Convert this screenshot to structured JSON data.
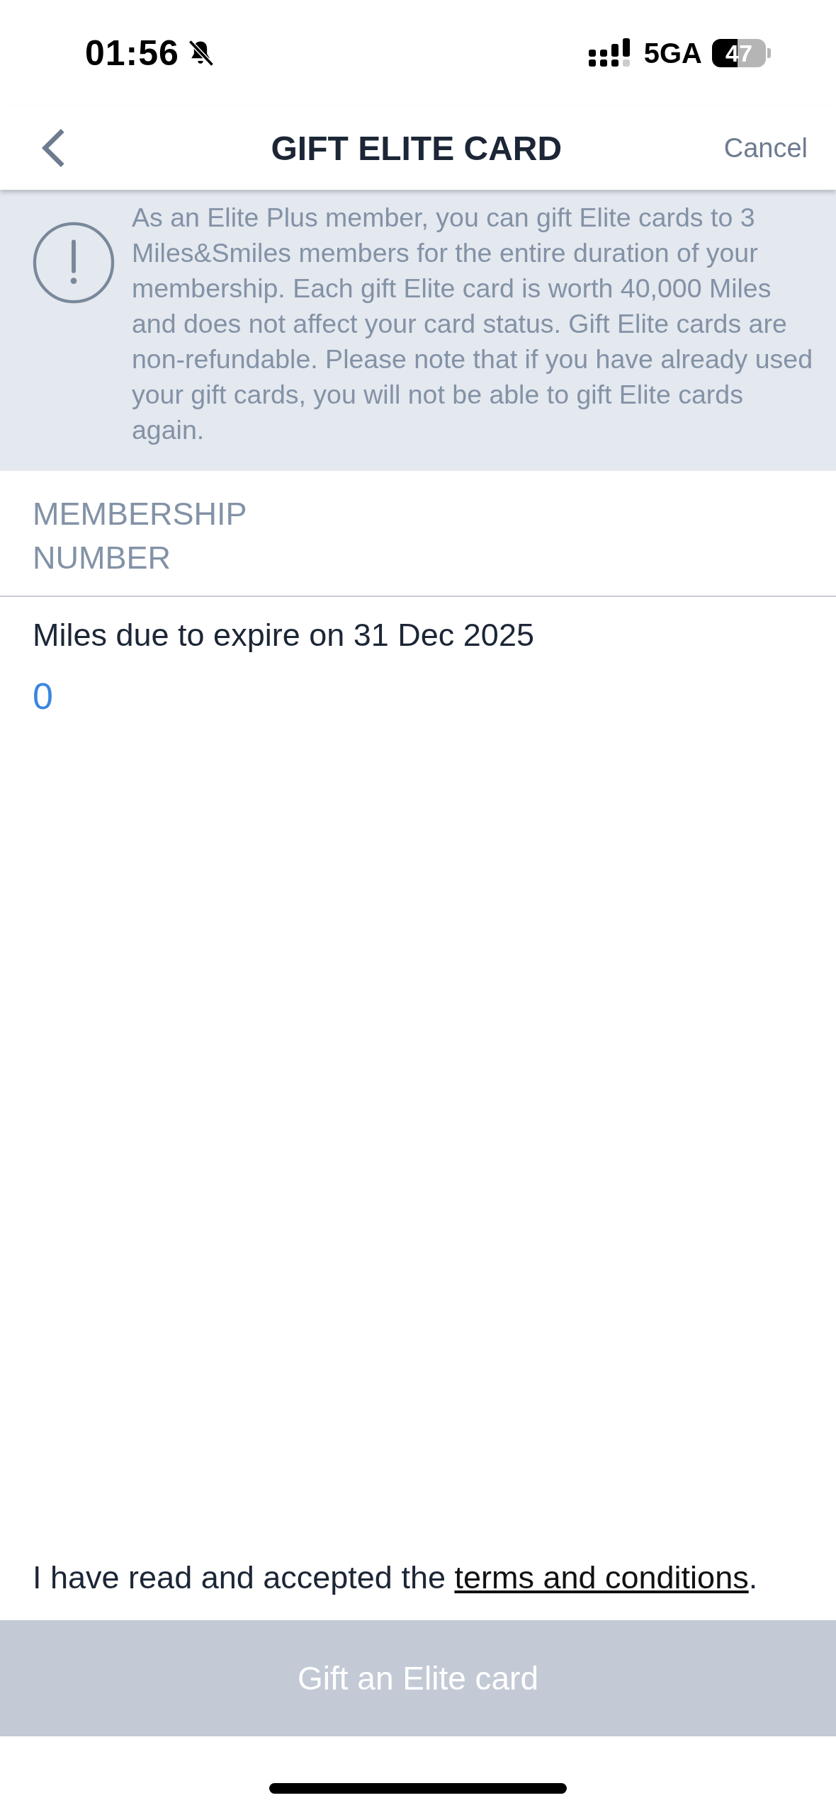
{
  "status_bar": {
    "time": "01:56",
    "network": "5GA",
    "battery": "47"
  },
  "nav": {
    "title": "GIFT ELITE CARD",
    "cancel": "Cancel"
  },
  "info": {
    "text": "As an Elite Plus member, you can gift Elite cards to 3 Miles&Smiles members for the entire duration of your membership. Each gift Elite card is worth 40,000 Miles and does not affect your card status. Gift Elite cards are non-refundable. Please note that if you have already used your gift cards, you will not be able to gift Elite cards again."
  },
  "membership_field": {
    "placeholder": "MEMBERSHIP NUMBER"
  },
  "miles": {
    "label": "Miles due to expire on 31 Dec 2025",
    "value": "0"
  },
  "terms": {
    "text": "I have read and accepted the",
    "link": "terms and conditions",
    "end": "."
  },
  "gift_button": {
    "label": "Gift an Elite card",
    "disabled": true
  }
}
